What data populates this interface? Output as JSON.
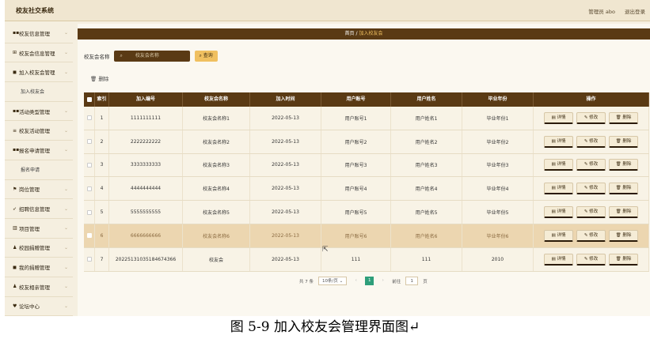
{
  "app": {
    "title": "校友社交系统",
    "admin": "管理员 abo",
    "logout": "退出登录"
  },
  "sidebar": [
    {
      "icon": "grid-icon",
      "glyph": "▪▪",
      "label": "校友信息管理",
      "sub": false,
      "arrow": true
    },
    {
      "icon": "table-icon",
      "glyph": "⊞",
      "label": "校友会信息管理",
      "sub": false,
      "arrow": true
    },
    {
      "icon": "building-icon",
      "glyph": "◼",
      "label": "加入校友会管理",
      "sub": false,
      "arrow": true
    },
    {
      "icon": "",
      "glyph": "",
      "label": "加入校友会",
      "sub": true,
      "arrow": false
    },
    {
      "icon": "grid-icon",
      "glyph": "▪▪",
      "label": "活动类型管理",
      "sub": false,
      "arrow": true
    },
    {
      "icon": "list-icon",
      "glyph": "≡",
      "label": "校友活动管理",
      "sub": false,
      "arrow": true
    },
    {
      "icon": "grid-icon",
      "glyph": "▪▪",
      "label": "报名申请管理",
      "sub": false,
      "arrow": true
    },
    {
      "icon": "",
      "glyph": "",
      "label": "报名申请",
      "sub": true,
      "arrow": false
    },
    {
      "icon": "flag-icon",
      "glyph": "⚑",
      "label": "岗位管理",
      "sub": false,
      "arrow": true
    },
    {
      "icon": "send-icon",
      "glyph": "➶",
      "label": "招聘信息管理",
      "sub": false,
      "arrow": true
    },
    {
      "icon": "chart-icon",
      "glyph": "▥",
      "label": "项目管理",
      "sub": false,
      "arrow": true
    },
    {
      "icon": "user-icon",
      "glyph": "♟",
      "label": "校园捐赠管理",
      "sub": false,
      "arrow": true
    },
    {
      "icon": "building-icon",
      "glyph": "◼",
      "label": "我的捐赠管理",
      "sub": false,
      "arrow": true
    },
    {
      "icon": "user-icon",
      "glyph": "♟",
      "label": "校友相亲管理",
      "sub": false,
      "arrow": true
    },
    {
      "icon": "forum-icon",
      "glyph": "♥",
      "label": "论坛中心",
      "sub": false,
      "arrow": true
    }
  ],
  "breadcrumb": {
    "home": "首页",
    "sep": "/",
    "current": "加入校友会"
  },
  "search": {
    "label": "校友会名称",
    "placeholder": "校友会名称",
    "button": "查询"
  },
  "delete_button": "删除",
  "table": {
    "headers": [
      "索引",
      "加入编号",
      "校友会名称",
      "加入时间",
      "用户账号",
      "用户姓名",
      "毕业年份",
      "操作"
    ],
    "rows": [
      [
        "1",
        "1111111111",
        "校友会名称1",
        "2022-05-13",
        "用户账号1",
        "用户姓名1",
        "毕业年份1"
      ],
      [
        "2",
        "2222222222",
        "校友会名称2",
        "2022-05-13",
        "用户账号2",
        "用户姓名2",
        "毕业年份2"
      ],
      [
        "3",
        "3333333333",
        "校友会名称3",
        "2022-05-13",
        "用户账号3",
        "用户姓名3",
        "毕业年份3"
      ],
      [
        "4",
        "4444444444",
        "校友会名称4",
        "2022-05-13",
        "用户账号4",
        "用户姓名4",
        "毕业年份4"
      ],
      [
        "5",
        "5555555555",
        "校友会名称5",
        "2022-05-13",
        "用户账号5",
        "用户姓名5",
        "毕业年份5"
      ],
      [
        "6",
        "6666666666",
        "校友会名称6",
        "2022-05-13",
        "用户账号6",
        "用户姓名6",
        "毕业年份6"
      ],
      [
        "7",
        "20225131035184674366",
        "校友会",
        "2022-05-13",
        "111",
        "111",
        "2010"
      ]
    ],
    "highlight_row": 6,
    "actions": [
      "详情",
      "修改",
      "删除"
    ]
  },
  "pager": {
    "total": "共 7 条",
    "size": "10条/页",
    "page": "1",
    "goto": "前往",
    "goto_value": "1",
    "unit": "页"
  },
  "caption": "图 5-9 加入校友会管理界面图↵"
}
